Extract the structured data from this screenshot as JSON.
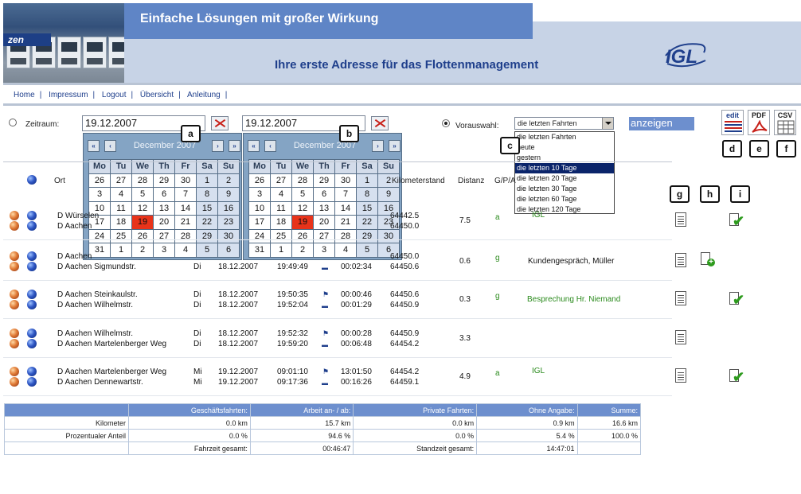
{
  "header": {
    "slogan": "Einfache Lösungen mit großer Wirkung",
    "tagline": "Ihre erste Adresse für das Flottenmanagement",
    "logo_text": "IGL",
    "photo_logo_text": "zen"
  },
  "nav": {
    "items": [
      "Home",
      "Impressum",
      "Logout",
      "Übersicht",
      "Anleitung"
    ],
    "separator": "|"
  },
  "filter": {
    "zeitraum_label": "Zeitraum:",
    "date_from": "19.12.2007",
    "date_to": "19.12.2007",
    "vorauswahl_label": "Vorauswahl:",
    "vorauswahl_value": "die letzten Fahrten",
    "options": [
      "die letzten Fahrten",
      "heute",
      "gestern",
      "die letzten 10 Tage",
      "die letzten 20 Tage",
      "die letzten 30 Tage",
      "die letzten 60 Tage",
      "die letzten 120 Tage"
    ],
    "selected_option_index": 3,
    "anzeigen_label": "anzeigen",
    "radio_zeitraum_selected": false,
    "radio_vorauswahl_selected": true
  },
  "exports": {
    "edit": "edit",
    "pdf": "PDF",
    "csv": "CSV"
  },
  "callouts": [
    "a",
    "b",
    "c",
    "d",
    "e",
    "f",
    "g",
    "h",
    "i"
  ],
  "calendar": {
    "month_label": "December 2007",
    "nav": [
      "«",
      "‹",
      "›",
      "»"
    ],
    "dow": [
      "Mo",
      "Tu",
      "We",
      "Th",
      "Fr",
      "Sa",
      "Su"
    ],
    "weeks": [
      [
        "26",
        "27",
        "28",
        "29",
        "30",
        "1",
        "2"
      ],
      [
        "3",
        "4",
        "5",
        "6",
        "7",
        "8",
        "9"
      ],
      [
        "10",
        "11",
        "12",
        "13",
        "14",
        "15",
        "16"
      ],
      [
        "17",
        "18",
        "19",
        "20",
        "21",
        "22",
        "23"
      ],
      [
        "24",
        "25",
        "26",
        "27",
        "28",
        "29",
        "30"
      ],
      [
        "31",
        "1",
        "2",
        "3",
        "4",
        "5",
        "6"
      ]
    ],
    "today": "19"
  },
  "table": {
    "headers": {
      "ort": "Ort",
      "kilometerstand": "Kilometerstand",
      "distanz": "Distanz",
      "gpa": "G/P/A"
    },
    "rows": [
      {
        "start_place": "D Würselen",
        "end_place": "D Aachen",
        "weekday_a": "",
        "weekday_b": "",
        "date_a": "",
        "date_b": "",
        "time_a": "",
        "time_b": "",
        "dur_a": "",
        "dur_b": "",
        "km_a": "64442.5",
        "km_b": "64450.0",
        "distance": "7.5",
        "gpa": "a",
        "note": "IGL",
        "has_check": true,
        "has_plus": false
      },
      {
        "start_place": "D Aachen",
        "end_place": "D Aachen Sigmundstr.",
        "weekday_a": "",
        "weekday_b": "Di",
        "date_a": "",
        "date_b": "18.12.2007",
        "time_a": "",
        "time_b": "19:49:49",
        "dur_a": "",
        "dur_b": "00:02:34",
        "km_a": "64450.0",
        "km_b": "64450.6",
        "distance": "0.6",
        "gpa": "g",
        "note": "Kundengespräch, Müller",
        "has_check": false,
        "has_plus": true
      },
      {
        "start_place": "D Aachen Steinkaulstr.",
        "end_place": "D Aachen Wilhelmstr.",
        "weekday_a": "Di",
        "weekday_b": "Di",
        "date_a": "18.12.2007",
        "date_b": "18.12.2007",
        "time_a": "19:50:35",
        "time_b": "19:52:04",
        "dur_a": "00:00:46",
        "dur_b": "00:01:29",
        "km_a": "64450.6",
        "km_b": "64450.9",
        "distance": "0.3",
        "gpa": "g",
        "note": "Besprechung Hr. Niemand",
        "has_check": true,
        "has_plus": false
      },
      {
        "start_place": "D Aachen Wilhelmstr.",
        "end_place": "D Aachen Martelenberger Weg",
        "weekday_a": "Di",
        "weekday_b": "Di",
        "date_a": "18.12.2007",
        "date_b": "18.12.2007",
        "time_a": "19:52:32",
        "time_b": "19:59:20",
        "dur_a": "00:00:28",
        "dur_b": "00:06:48",
        "km_a": "64450.9",
        "km_b": "64454.2",
        "distance": "3.3",
        "gpa": "",
        "note": "",
        "has_check": false,
        "has_plus": false
      },
      {
        "start_place": "D Aachen Martelenberger Weg",
        "end_place": "D Aachen Dennewartstr.",
        "weekday_a": "Mi",
        "weekday_b": "Mi",
        "date_a": "19.12.2007",
        "date_b": "19.12.2007",
        "time_a": "09:01:10",
        "time_b": "09:17:36",
        "dur_a": "13:01:50",
        "dur_b": "00:16:26",
        "km_a": "64454.2",
        "km_b": "64459.1",
        "distance": "4.9",
        "gpa": "a",
        "note": "IGL",
        "has_check": true,
        "has_plus": false
      }
    ]
  },
  "summary": {
    "headers": [
      "",
      "Geschäftsfahrten:",
      "Arbeit an- / ab:",
      "Private Fahrten:",
      "Ohne Angabe:",
      "Summe:"
    ],
    "km_row": [
      "Kilometer",
      "0.0 km",
      "15.7 km",
      "0.0 km",
      "0.9 km",
      "16.6 km"
    ],
    "pct_row": [
      "Prozentualer Anteil",
      "0.0  %",
      "94.6  %",
      "0.0  %",
      "5.4  %",
      "100.0  %"
    ],
    "time_row": [
      "",
      "Fahrzeit gesamt:",
      "00:46:47",
      "Standzeit gesamt:",
      "14:47:01",
      ""
    ]
  },
  "colors": {
    "header_blue": "#5f85c6",
    "header_light": "#c7d3e6",
    "brand_text": "#1f3f8c",
    "calendar_bg": "#84a4c4",
    "today_red": "#e8331a",
    "note_green": "#2a8a1c"
  }
}
